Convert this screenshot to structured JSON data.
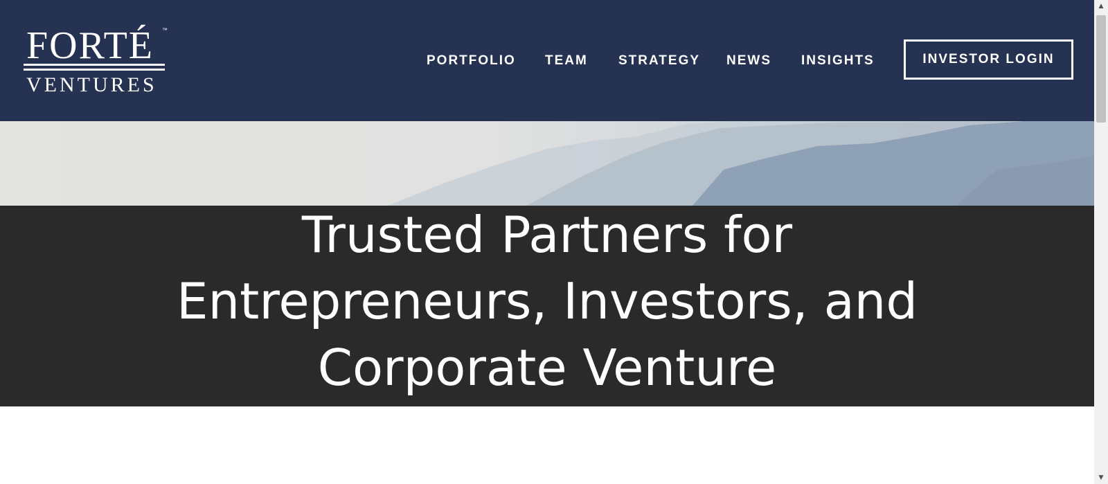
{
  "brand": {
    "logo_top": "FORTÉ",
    "logo_tm": "™",
    "logo_bottom": "VENTURES"
  },
  "nav": {
    "items": [
      {
        "label": "PORTFOLIO"
      },
      {
        "label": "TEAM"
      },
      {
        "label": "STRATEGY"
      },
      {
        "label": "NEWS"
      },
      {
        "label": "INSIGHTS"
      }
    ],
    "login_label": "INVESTOR LOGIN"
  },
  "hero": {
    "title_lines": [
      "Trusted Partners for",
      "Entrepreneurs, Investors, and",
      "Corporate Venture"
    ]
  },
  "colors": {
    "header_bg": "#263252",
    "hero_dark": "#2a2a2a",
    "text_light": "#ffffff"
  },
  "icons": {
    "scroll_up": "scroll-up-arrow-icon",
    "scroll_down": "scroll-down-arrow-icon"
  }
}
